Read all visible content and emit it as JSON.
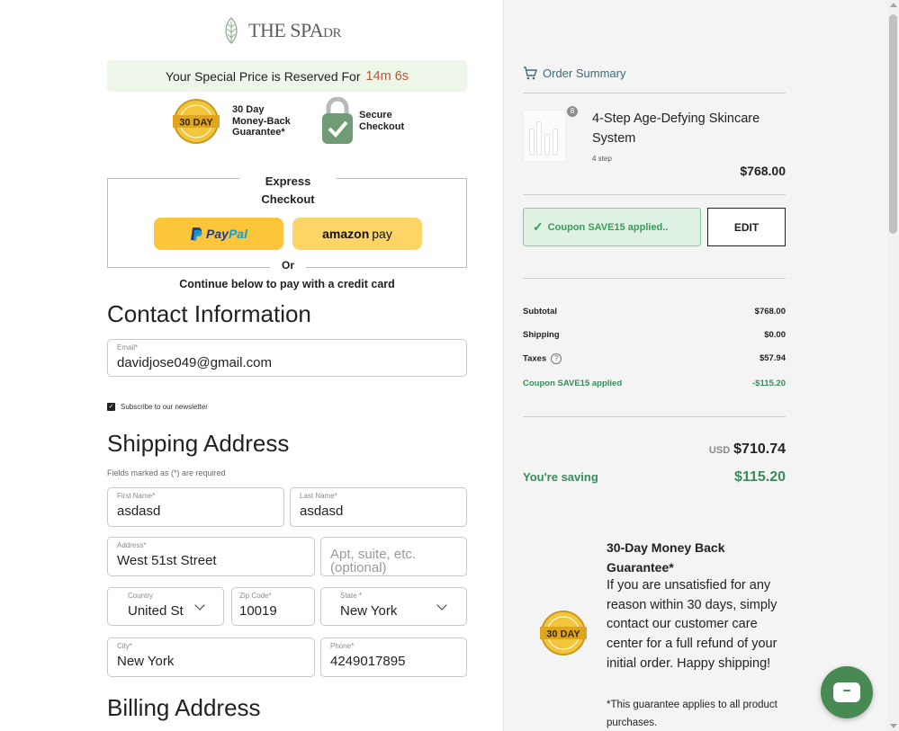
{
  "logo": {
    "text_main": "THE SPA",
    "text_small": "DR"
  },
  "timer": {
    "label": "Your Special Price is Reserved For",
    "time": "14m 6s"
  },
  "badges": {
    "badge_text": "30 DAY",
    "guarantee": [
      "30 Day",
      "Money-Back",
      "Guarantee*"
    ],
    "secure": [
      "Secure",
      "Checkout"
    ]
  },
  "express": {
    "title_line1": "Express",
    "title_line2": "Checkout",
    "paypal_a": "Pay",
    "paypal_b": "Pal",
    "amazon_a": "amazon",
    "amazon_b": "pay",
    "or": "Or",
    "continue": "Continue below to pay with a credit card"
  },
  "contact": {
    "heading": "Contact Information",
    "email_label": "Email*",
    "email_value": "davidjose049@gmail.com",
    "newsletter": "Subscribe to our newsletter",
    "newsletter_checked": true
  },
  "shipping": {
    "heading": "Shipping Address",
    "required_note": "Fields marked as (*) are required",
    "first_name_label": "First Name*",
    "first_name": "asdasd",
    "last_name_label": "Last Name*",
    "last_name": "asdasd",
    "address_label": "Address*",
    "address": "West 51st Street",
    "apt_placeholder": "Apt, suite, etc. (optional)",
    "country_label": "Country",
    "country": "United St",
    "zip_label": "Zip Code*",
    "zip": "10019",
    "state_label": "State *",
    "state": "New York",
    "city_label": "City*",
    "city": "New York",
    "phone_label": "Phone*",
    "phone": "4249017895"
  },
  "billing": {
    "heading": "Billing Address"
  },
  "order": {
    "heading": "Order Summary",
    "quantity": "8",
    "product_name": "4-Step Age-Defying Skincare System",
    "product_sub": "4 step",
    "product_price": "$768.00",
    "coupon_text": "Coupon SAVE15 applied..",
    "edit": "EDIT",
    "rows": [
      {
        "label": "Subtotal",
        "value": "$768.00"
      },
      {
        "label": "Shipping",
        "value": "$0.00"
      },
      {
        "label": "Taxes",
        "value": "$57.94"
      },
      {
        "label": "Coupon SAVE15 applied",
        "value": "-$115.20"
      }
    ],
    "currency": "USD",
    "total": "$710.74",
    "saving_label": "You're saving",
    "saving_value": "$115.20"
  },
  "guarantee": {
    "title": "30-Day Money Back Guarantee*",
    "body": "If you are unsatisfied for any reason within 30 days, simply contact our customer care center for a full refund of your initial order. Happy shipping!",
    "note": "*This guarantee applies to all product purchases."
  },
  "colors": {
    "accent_green": "#478a53",
    "timer_bg": "#eef6ea",
    "paypal_yellow": "#fcc53a"
  }
}
